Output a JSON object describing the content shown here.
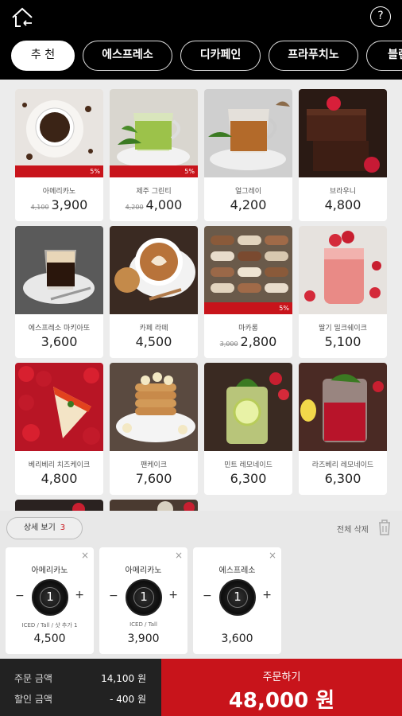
{
  "header": {
    "help_label": "?",
    "tabs": [
      {
        "label": "추 천",
        "active": true
      },
      {
        "label": "에스프레소",
        "active": false
      },
      {
        "label": "디카페인",
        "active": false
      },
      {
        "label": "프라푸치노",
        "active": false
      },
      {
        "label": "블렌",
        "active": false
      }
    ]
  },
  "menu": [
    {
      "name": "아메리카노",
      "orig": "4,100",
      "price": "3,900",
      "sale": "5%"
    },
    {
      "name": "제주 그린티",
      "orig": "4,200",
      "price": "4,000",
      "sale": "5%"
    },
    {
      "name": "얼그레이",
      "orig": "",
      "price": "4,200",
      "sale": ""
    },
    {
      "name": "브라우니",
      "orig": "",
      "price": "4,800",
      "sale": ""
    },
    {
      "name": "에스프레소 마키아또",
      "orig": "",
      "price": "3,600",
      "sale": ""
    },
    {
      "name": "카페 라떼",
      "orig": "",
      "price": "4,500",
      "sale": ""
    },
    {
      "name": "마카롱",
      "orig": "3,000",
      "price": "2,800",
      "sale": "5%"
    },
    {
      "name": "딸기 밀크쉐이크",
      "orig": "",
      "price": "5,100",
      "sale": ""
    },
    {
      "name": "베리베리 치즈케이크",
      "orig": "",
      "price": "4,800",
      "sale": ""
    },
    {
      "name": "팬케이크",
      "orig": "",
      "price": "7,600",
      "sale": ""
    },
    {
      "name": "민트 레모네이드",
      "orig": "",
      "price": "6,300",
      "sale": ""
    },
    {
      "name": "라즈베리 레모네이드",
      "orig": "",
      "price": "6,300",
      "sale": ""
    }
  ],
  "cart": {
    "detail_label": "상세 보기",
    "detail_count": "3",
    "delete_all": "전체 삭제",
    "items": [
      {
        "name": "아메리카노",
        "qty": "1",
        "option": "ICED / Tall / 샷 추가 1",
        "price": "4,500"
      },
      {
        "name": "아메리카노",
        "qty": "1",
        "option": "ICED / Tall",
        "price": "3,900"
      },
      {
        "name": "에스프레소",
        "qty": "1",
        "option": "",
        "price": "3,600"
      }
    ],
    "minus_label": "−",
    "plus_label": "+",
    "close_label": "×"
  },
  "summary": {
    "order_amount_label": "주문 금액",
    "order_amount": "14,100 원",
    "discount_label": "할인 금액",
    "discount": "- 400 원"
  },
  "order": {
    "label": "주문하기",
    "total": "48,000 원"
  },
  "colors": {
    "accent": "#c8141b",
    "topbar": "#000000",
    "footer": "#222222"
  }
}
